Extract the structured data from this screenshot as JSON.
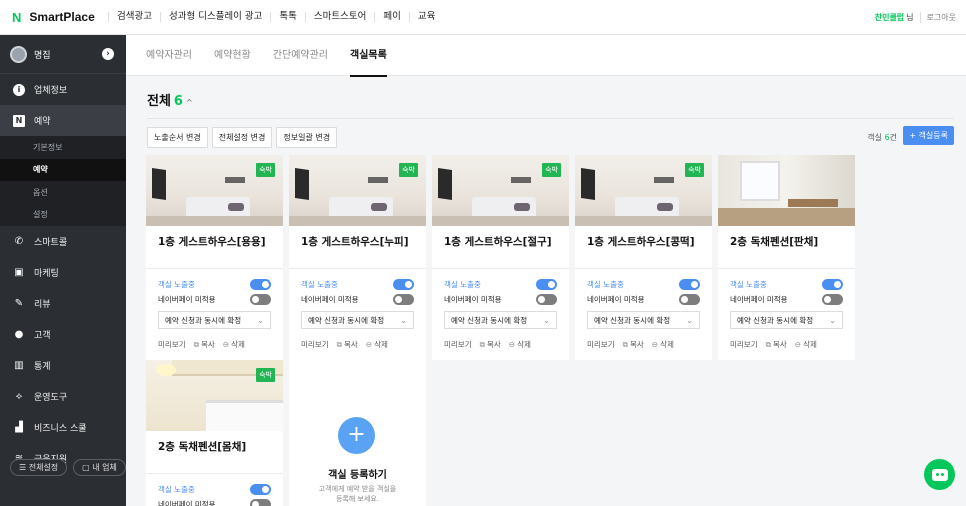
{
  "header": {
    "logo_mark": "N",
    "logo_text": "SmartPlace",
    "nav": [
      "검색광고",
      "성과형 디스플레이 광고",
      "톡톡",
      "스마트스토어",
      "페이",
      "교육"
    ],
    "user_name": "찬민클럽",
    "user_suffix": "님",
    "logout": "로그아웃"
  },
  "sidebar": {
    "store_name": "명집",
    "menu": {
      "business_info": "업체정보",
      "reservation": "예약",
      "smartcall": "스마트콜",
      "marketing": "마케팅",
      "review": "리뷰",
      "customer": "고객",
      "stats": "통계",
      "tools": "운영도구",
      "school": "비즈니스 스쿨",
      "finance": "금융지원"
    },
    "submenu": [
      "기본정보",
      "예약",
      "옵션",
      "설정"
    ],
    "bottom": {
      "all_settings": "전체설정",
      "my_business": "내 업체"
    }
  },
  "tabs": [
    "예약자관리",
    "예약현황",
    "간단예약관리",
    "객실목록"
  ],
  "main": {
    "title": "전체",
    "count": "6",
    "actions": [
      "노출순서 변경",
      "전체설정 변경",
      "정보일괄 변경"
    ],
    "room_count_prefix": "객실 ",
    "room_count_num": "6",
    "room_count_suffix": "건",
    "add_button": "+ 객실등록"
  },
  "card_labels": {
    "badge": "숙박",
    "exposure": "객실 노출중",
    "naverpay": "네이버페이 미적용",
    "select": "예약 신청과 동시에 확정",
    "preview": "미리보기",
    "copy": "복사",
    "delete": "삭제"
  },
  "rooms": [
    {
      "name": "1층 게스트하우스[용용]",
      "exposure_on": true,
      "naverpay_on": false
    },
    {
      "name": "1층 게스트하우스[누피]",
      "exposure_on": true,
      "naverpay_on": false
    },
    {
      "name": "1층 게스트하우스[절구]",
      "exposure_on": true,
      "naverpay_on": false
    },
    {
      "name": "1층 게스트하우스[콩떡]",
      "exposure_on": true,
      "naverpay_on": false
    },
    {
      "name": "2층 독채펜션[판채]",
      "exposure_on": true,
      "naverpay_on": false
    },
    {
      "name": "2층 독채펜션[몸채]",
      "exposure_on": true,
      "naverpay_on": false
    }
  ],
  "add_card": {
    "title": "객실 등록하기",
    "desc_line1": "고객에게 예약 받을 객실을",
    "desc_line2": "등록해 보세요."
  },
  "colors": {
    "brand_green": "#03c75a",
    "toggle_on": "#4a8ef2",
    "sidebar_bg": "#2b2e33"
  }
}
